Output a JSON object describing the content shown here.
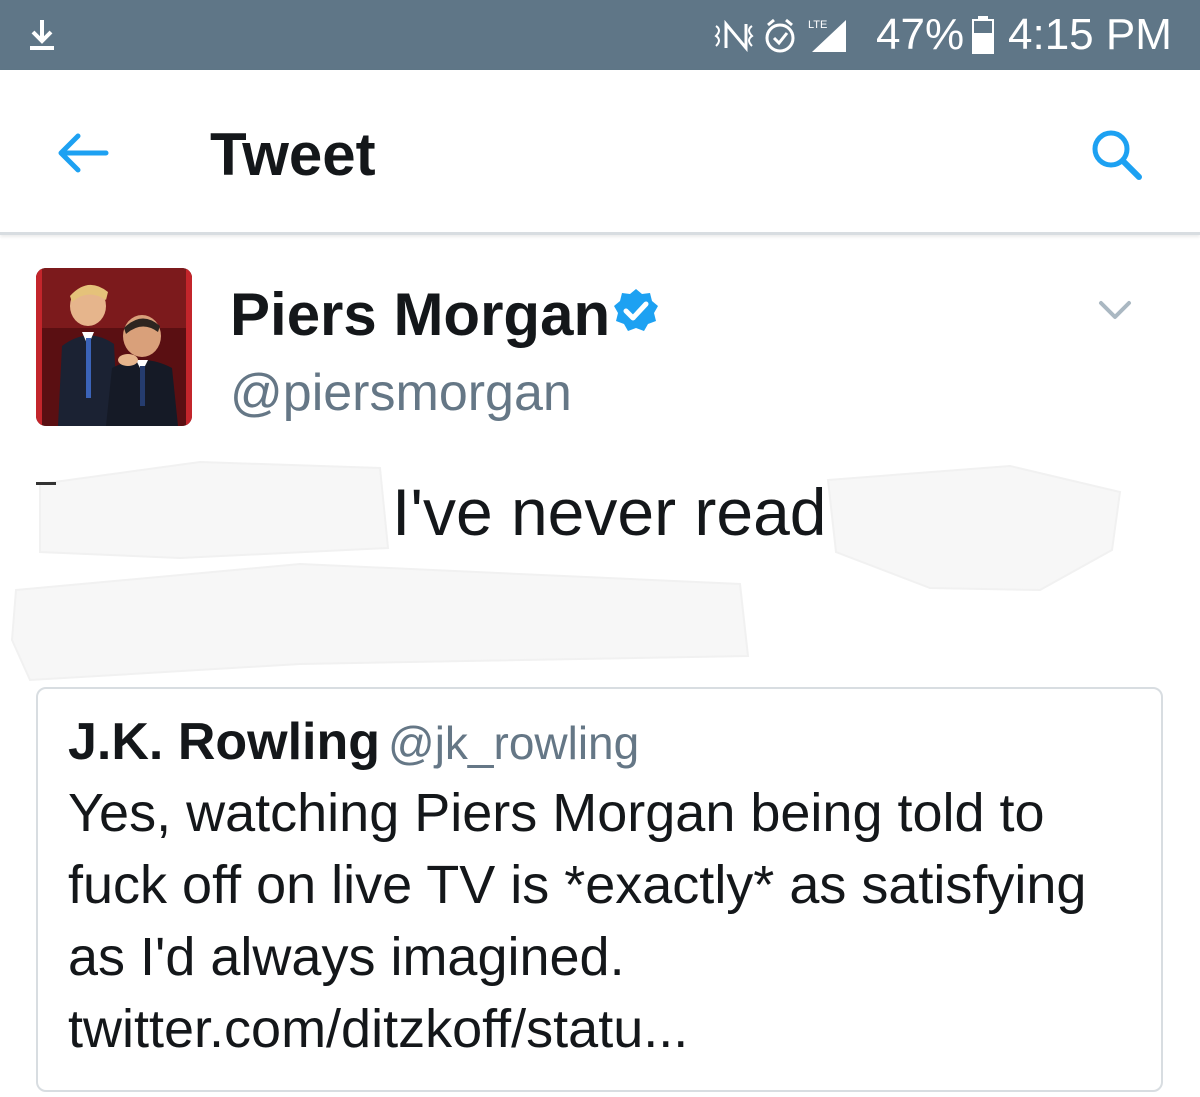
{
  "status_bar": {
    "battery_percent": "47%",
    "time": "4:15 PM",
    "network_label": "LTE",
    "icons": [
      "download-icon",
      "no-signal-icon",
      "alarm-icon",
      "lte-signal-icon",
      "battery-icon"
    ]
  },
  "header": {
    "title": "Tweet",
    "icons": [
      "back-arrow-icon",
      "search-icon"
    ]
  },
  "tweet": {
    "author_name": "Piers Morgan",
    "author_handle": "@piersmorgan",
    "visible_text": "I've never read",
    "icons": [
      "verified-badge-icon",
      "chevron-down-icon"
    ]
  },
  "quoted_tweet": {
    "author_name": "J.K. Rowling",
    "author_handle": "@jk_rowling",
    "text": "Yes, watching Piers Morgan being told to fuck off on live TV is *exactly* as satisfying as I'd always imagined. twitter.com/ditzkoff/statu..."
  },
  "colors": {
    "status_bar": "#5f7687",
    "accent": "#1da1f2",
    "secondary_text": "#657786",
    "primary_text": "#14171a",
    "divider": "#d8dde1"
  }
}
